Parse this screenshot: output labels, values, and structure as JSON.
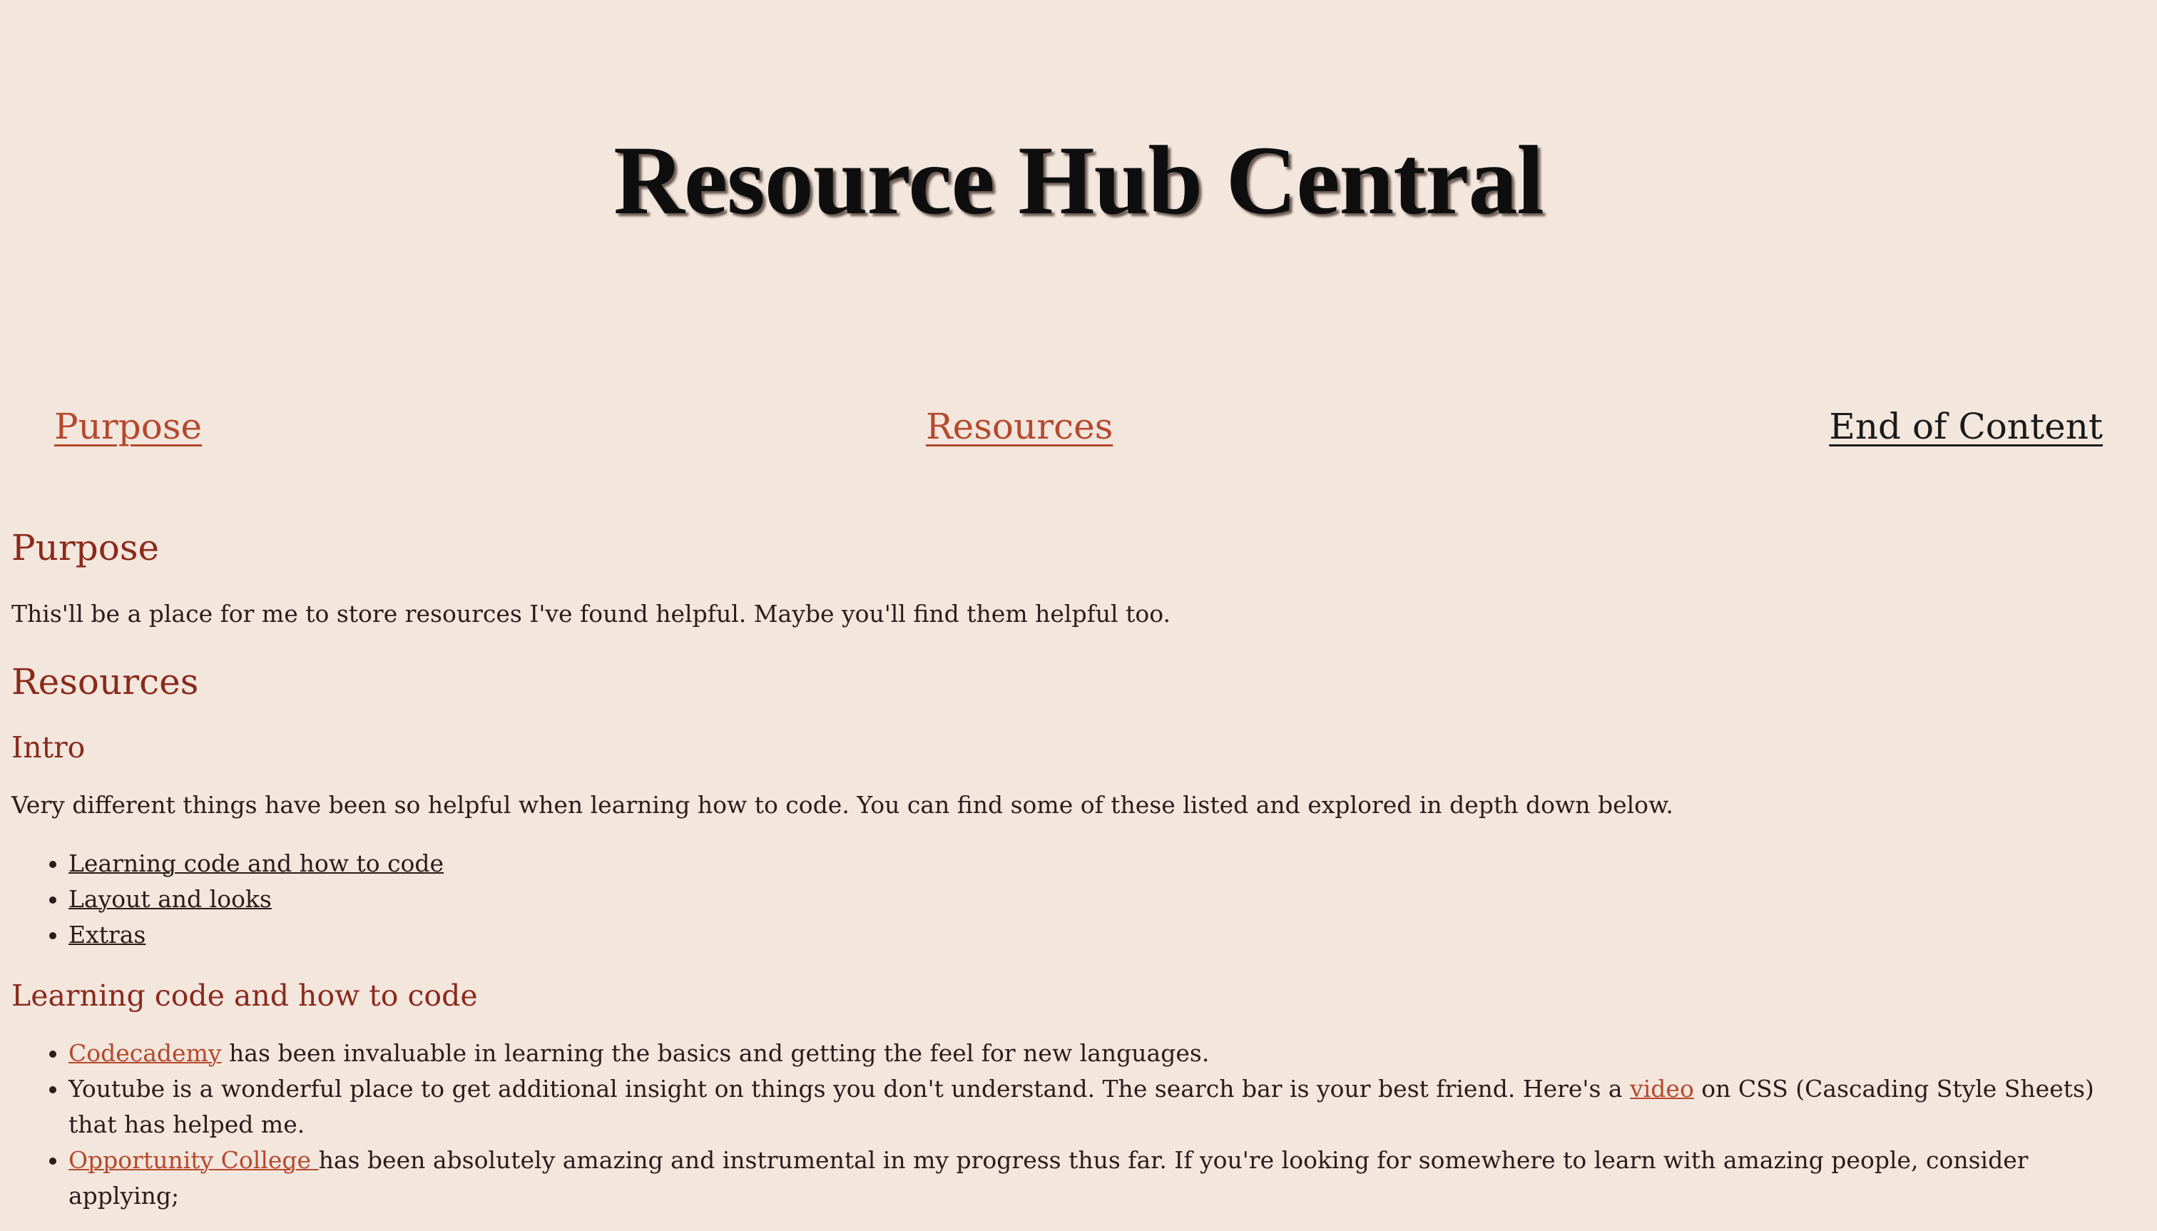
{
  "header": {
    "title": "Resource Hub Central"
  },
  "nav": {
    "purpose": "Purpose",
    "resources": "Resources",
    "end": "End of Content"
  },
  "purpose": {
    "heading": "Purpose",
    "text": "This'll be a place for me to store resources I've found helpful. Maybe you'll find them helpful too."
  },
  "resources": {
    "heading": "Resources",
    "intro": {
      "heading": "Intro",
      "text": "Very different things have been so helpful when learning how to code. You can find some of these listed and explored in depth down below.",
      "links": [
        "Learning code and how to code",
        "Layout and looks",
        "Extras"
      ]
    },
    "learning": {
      "heading": "Learning code and how to code",
      "items": [
        {
          "link": "Codecademy",
          "after": " has been invaluable in learning the basics and getting the feel for new languages."
        },
        {
          "before": "Youtube is a wonderful place to get additional insight on things you don't understand. The search bar is your best friend. Here's a ",
          "link": "video",
          "after": " on CSS (Cascading Style Sheets) that has helped me."
        },
        {
          "link": "Opportunity College ",
          "after": "has been absolutely amazing and instrumental in my progress thus far. If you're looking for somewhere to learn with amazing people, consider applying;"
        }
      ]
    }
  },
  "colors": {
    "background": "#f3e6dd",
    "heading": "#8a2a1c",
    "accent_link": "#b4492d",
    "text": "#2a1d1a"
  }
}
